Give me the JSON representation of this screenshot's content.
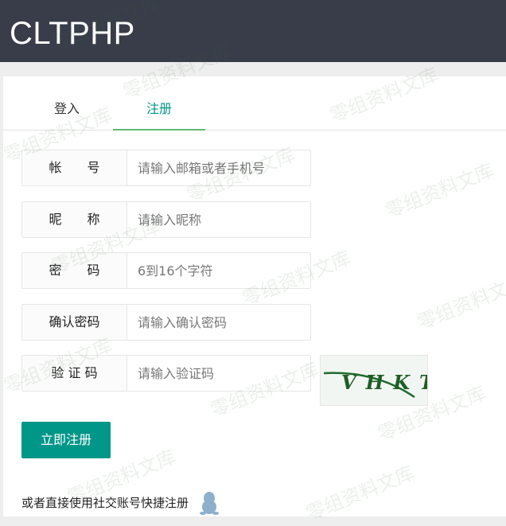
{
  "header": {
    "brand": "CLTPHP"
  },
  "tabs": [
    {
      "label": "登入",
      "active": false
    },
    {
      "label": "注册",
      "active": true
    }
  ],
  "form": {
    "fields": [
      {
        "label": "帐　　号",
        "placeholder": "请输入邮箱或者手机号"
      },
      {
        "label": "昵　　称",
        "placeholder": "请输入昵称"
      },
      {
        "label": "密　　码",
        "placeholder": "6到16个字符"
      },
      {
        "label": "确认密码",
        "placeholder": "请输入确认密码"
      },
      {
        "label": "验 证 码",
        "placeholder": "请输入验证码"
      }
    ],
    "captcha_text": "VHKT",
    "submit_label": "立即注册"
  },
  "social": {
    "text": "或者直接使用社交账号快捷注册",
    "icon": "qq-penguin-icon"
  },
  "watermark": "零组资料文库",
  "colors": {
    "header_bg": "#393d49",
    "accent": "#009688",
    "tab_underline": "#5FB878"
  }
}
